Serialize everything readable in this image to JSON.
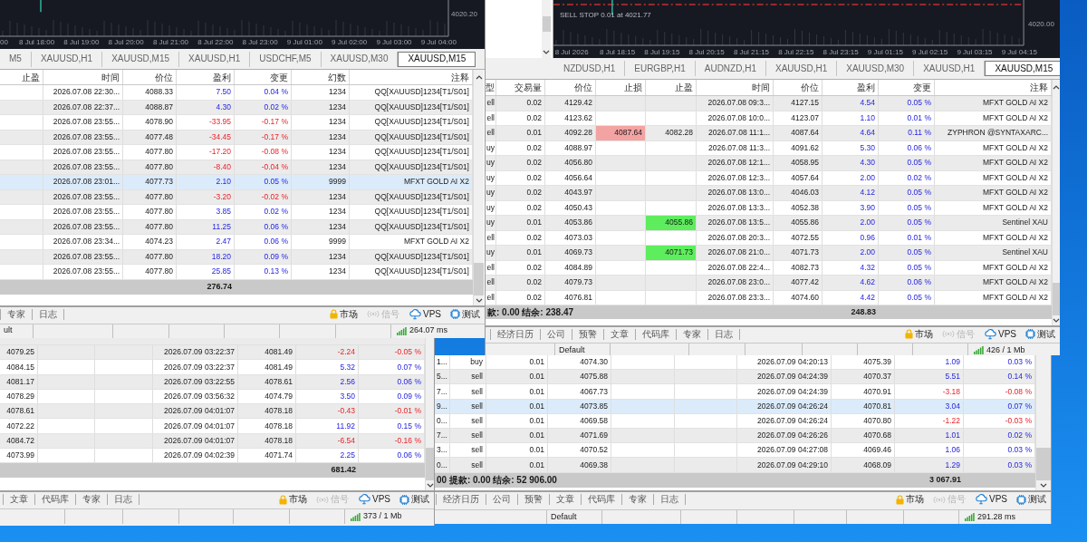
{
  "windows": [
    {
      "chart": {
        "time_labels": [
          "00",
          "8 Jul 18:00",
          "8 Jul 19:00",
          "8 Jul 20:00",
          "8 Jul 21:00",
          "8 Jul 22:00",
          "8 Jul 23:00",
          "9 Jul 01:00",
          "9 Jul 02:00",
          "9 Jul 03:00",
          "9 Jul 04:00"
        ],
        "price_labels": [
          "4020.20"
        ]
      },
      "chart_tabs": [
        {
          "label": "M5",
          "selected": false
        },
        {
          "label": "XAUUSD,H1",
          "selected": false
        },
        {
          "label": "XAUUSD,M15",
          "selected": false
        },
        {
          "label": "XAUUSD,H1",
          "selected": false
        },
        {
          "label": "USDCHF,M5",
          "selected": false
        },
        {
          "label": "XAUUSD,M30",
          "selected": false
        },
        {
          "label": "XAUUSD,M15",
          "selected": true
        }
      ],
      "table": {
        "columns": [
          "止盈",
          "时间",
          "价位",
          "盈利",
          "变更",
          "幻数",
          "注释"
        ],
        "rows": [
          {
            "cells": [
              null,
              "2026.07.08 22:30...",
              "4088.33",
              "7.50",
              "0.04 %",
              "1234",
              "QQ[XAUUSD]1234[T1/S01]"
            ],
            "negative": false,
            "selected": false
          },
          {
            "cells": [
              null,
              "2026.07.08 22:37...",
              "4088.87",
              "4.30",
              "0.02 %",
              "1234",
              "QQ[XAUUSD]1234[T1/S01]"
            ],
            "negative": false,
            "selected": false
          },
          {
            "cells": [
              null,
              "2026.07.08 23:55...",
              "4078.90",
              "-33.95",
              "-0.17 %",
              "1234",
              "QQ[XAUUSD]1234[T1/S01]"
            ],
            "negative": true,
            "selected": false
          },
          {
            "cells": [
              null,
              "2026.07.08 23:55...",
              "4077.48",
              "-34.45",
              "-0.17 %",
              "1234",
              "QQ[XAUUSD]1234[T1/S01]"
            ],
            "negative": true,
            "selected": false
          },
          {
            "cells": [
              null,
              "2026.07.08 23:55...",
              "4077.80",
              "-17.20",
              "-0.08 %",
              "1234",
              "QQ[XAUUSD]1234[T1/S01]"
            ],
            "negative": true,
            "selected": false
          },
          {
            "cells": [
              null,
              "2026.07.08 23:55...",
              "4077.80",
              "-8.40",
              "-0.04 %",
              "1234",
              "QQ[XAUUSD]1234[T1/S01]"
            ],
            "negative": true,
            "selected": false
          },
          {
            "cells": [
              null,
              "2026.07.08 23:01...",
              "4077.73",
              "2.10",
              "0.05 %",
              "9999",
              "MFXT GOLD AI X2"
            ],
            "negative": false,
            "selected": true
          },
          {
            "cells": [
              null,
              "2026.07.08 23:55...",
              "4077.80",
              "-3.20",
              "-0.02 %",
              "1234",
              "QQ[XAUUSD]1234[T1/S01]"
            ],
            "negative": true,
            "selected": false
          },
          {
            "cells": [
              null,
              "2026.07.08 23:55...",
              "4077.80",
              "3.85",
              "0.02 %",
              "1234",
              "QQ[XAUUSD]1234[T1/S01]"
            ],
            "negative": false,
            "selected": false
          },
          {
            "cells": [
              null,
              "2026.07.08 23:55...",
              "4077.80",
              "11.25",
              "0.06 %",
              "1234",
              "QQ[XAUUSD]1234[T1/S01]"
            ],
            "negative": false,
            "selected": false
          },
          {
            "cells": [
              null,
              "2026.07.08 23:34...",
              "4074.23",
              "2.47",
              "0.06 %",
              "9999",
              "MFXT GOLD AI X2"
            ],
            "negative": false,
            "selected": false
          },
          {
            "cells": [
              null,
              "2026.07.08 23:55...",
              "4077.80",
              "18.20",
              "0.09 %",
              "1234",
              "QQ[XAUUSD]1234[T1/S01]"
            ],
            "negative": false,
            "selected": false
          },
          {
            "cells": [
              null,
              "2026.07.08 23:55...",
              "4077.80",
              "25.85",
              "0.13 %",
              "1234",
              "QQ[XAUUSD]1234[T1/S01]"
            ],
            "negative": false,
            "selected": false
          }
        ],
        "total": {
          "profit": "276.74"
        }
      },
      "bottom_tabs": [
        "专家",
        "日志"
      ],
      "services": [
        {
          "kind": "market",
          "label": "市场",
          "disabled": false
        },
        {
          "kind": "signals",
          "label": "信号",
          "disabled": true
        },
        {
          "kind": "vps",
          "label": "VPS",
          "disabled": false
        },
        {
          "kind": "tester",
          "label": "测试",
          "disabled": false
        }
      ],
      "status": {
        "profile": "ult",
        "connection": "264.07 ms"
      }
    },
    {
      "chart": {
        "time_labels": [
          "8 Jul 2026",
          "8 Jul 18:15",
          "8 Jul 19:15",
          "8 Jul 20:15",
          "8 Jul 21:15",
          "8 Jul 22:15",
          "8 Jul 23:15",
          "9 Jul 01:15",
          "9 Jul 02:15",
          "9 Jul 03:15",
          "9 Jul 04:15"
        ],
        "price_labels": [
          "4020.00"
        ],
        "order_label": "SELL STOP 0.01 at 4021.77"
      },
      "chart_tabs": [
        {
          "label": "NZDUSD,H1",
          "selected": false
        },
        {
          "label": "EURGBP,H1",
          "selected": false
        },
        {
          "label": "AUDNZD,H1",
          "selected": false
        },
        {
          "label": "XAUUSD,H1",
          "selected": false
        },
        {
          "label": "XAUUSD,M30",
          "selected": false
        },
        {
          "label": "XAUUSD,H1",
          "selected": false
        },
        {
          "label": "XAUUSD,M15",
          "selected": true
        }
      ],
      "table": {
        "columns": [
          "型",
          "交易量",
          "价位",
          "止损",
          "止盈",
          "时间",
          "价位",
          "盈利",
          "变更",
          "注释"
        ],
        "rows": [
          {
            "cells": [
              "ell",
              "0.02",
              "4129.42",
              null,
              null,
              "2026.07.08 09:3...",
              "4127.15",
              "4.54",
              "0.05 %",
              "MFXT GOLD AI X2"
            ],
            "negative": false,
            "selected": false,
            "sl_hit": false,
            "tp_hit": false
          },
          {
            "cells": [
              "ell",
              "0.02",
              "4123.62",
              null,
              null,
              "2026.07.08 10:0...",
              "4123.07",
              "1.10",
              "0.01 %",
              "MFXT GOLD AI X2"
            ],
            "negative": false,
            "selected": false,
            "sl_hit": false,
            "tp_hit": false
          },
          {
            "cells": [
              "ell",
              "0.01",
              "4092.28",
              "4087.64",
              "4082.28",
              "2026.07.08 11:1...",
              "4087.64",
              "4.64",
              "0.11 %",
              "ZYPHRON @SYNTAXARC..."
            ],
            "negative": false,
            "selected": false,
            "sl_hit": true,
            "tp_hit": false
          },
          {
            "cells": [
              "uy",
              "0.02",
              "4088.97",
              null,
              null,
              "2026.07.08 11:3...",
              "4091.62",
              "5.30",
              "0.06 %",
              "MFXT GOLD AI X2"
            ],
            "negative": false,
            "selected": false,
            "sl_hit": false,
            "tp_hit": false
          },
          {
            "cells": [
              "uy",
              "0.02",
              "4056.80",
              null,
              null,
              "2026.07.08 12:1...",
              "4058.95",
              "4.30",
              "0.05 %",
              "MFXT GOLD AI X2"
            ],
            "negative": false,
            "selected": false,
            "sl_hit": false,
            "tp_hit": false
          },
          {
            "cells": [
              "uy",
              "0.02",
              "4056.64",
              null,
              null,
              "2026.07.08 12:3...",
              "4057.64",
              "2.00",
              "0.02 %",
              "MFXT GOLD AI X2"
            ],
            "negative": false,
            "selected": false,
            "sl_hit": false,
            "tp_hit": false
          },
          {
            "cells": [
              "uy",
              "0.02",
              "4043.97",
              null,
              null,
              "2026.07.08 13:0...",
              "4046.03",
              "4.12",
              "0.05 %",
              "MFXT GOLD AI X2"
            ],
            "negative": false,
            "selected": false,
            "sl_hit": false,
            "tp_hit": false
          },
          {
            "cells": [
              "uy",
              "0.02",
              "4050.43",
              null,
              null,
              "2026.07.08 13:3...",
              "4052.38",
              "3.90",
              "0.05 %",
              "MFXT GOLD AI X2"
            ],
            "negative": false,
            "selected": false,
            "sl_hit": false,
            "tp_hit": false
          },
          {
            "cells": [
              "uy",
              "0.01",
              "4053.86",
              null,
              "4055.86",
              "2026.07.08 13:5...",
              "4055.86",
              "2.00",
              "0.05 %",
              "Sentinel XAU"
            ],
            "negative": false,
            "selected": false,
            "sl_hit": false,
            "tp_hit": true
          },
          {
            "cells": [
              "ell",
              "0.02",
              "4073.03",
              null,
              null,
              "2026.07.08 20:3...",
              "4072.55",
              "0.96",
              "0.01 %",
              "MFXT GOLD AI X2"
            ],
            "negative": false,
            "selected": false,
            "sl_hit": false,
            "tp_hit": false
          },
          {
            "cells": [
              "uy",
              "0.01",
              "4069.73",
              null,
              "4071.73",
              "2026.07.08 21:0...",
              "4071.73",
              "2.00",
              "0.05 %",
              "Sentinel XAU"
            ],
            "negative": false,
            "selected": false,
            "sl_hit": false,
            "tp_hit": true
          },
          {
            "cells": [
              "ell",
              "0.02",
              "4084.89",
              null,
              null,
              "2026.07.08 22:4...",
              "4082.73",
              "4.32",
              "0.05 %",
              "MFXT GOLD AI X2"
            ],
            "negative": false,
            "selected": false,
            "sl_hit": false,
            "tp_hit": false
          },
          {
            "cells": [
              "ell",
              "0.02",
              "4079.73",
              null,
              null,
              "2026.07.08 23:0...",
              "4077.42",
              "4.62",
              "0.06 %",
              "MFXT GOLD AI X2"
            ],
            "negative": false,
            "selected": false,
            "sl_hit": false,
            "tp_hit": false
          },
          {
            "cells": [
              "ell",
              "0.02",
              "4076.81",
              null,
              null,
              "2026.07.08 23:3...",
              "4074.60",
              "4.42",
              "0.05 %",
              "MFXT GOLD AI X2"
            ],
            "negative": false,
            "selected": false,
            "sl_hit": false,
            "tp_hit": false
          }
        ],
        "total": {
          "summary": "款: 0.00  结余: 238.47",
          "profit": "248.83"
        }
      },
      "bottom_tabs": [
        "经济日历",
        "公司",
        "预警",
        "文章",
        "代码库",
        "专家",
        "日志"
      ],
      "services": [
        {
          "kind": "market",
          "label": "市场",
          "disabled": false
        },
        {
          "kind": "signals",
          "label": "信号",
          "disabled": true
        },
        {
          "kind": "vps",
          "label": "VPS",
          "disabled": false
        },
        {
          "kind": "tester",
          "label": "测试",
          "disabled": false
        }
      ],
      "status": {
        "profile": "Default",
        "connection": "426 / 1 Mb"
      }
    },
    {
      "table": {
        "rows": [
          {
            "cells": [
              "4079.25",
              null,
              null,
              "2026.07.09 03:22:37",
              "4081.49",
              "-2.24",
              "-0.05 %"
            ],
            "negative": true,
            "selected": false
          },
          {
            "cells": [
              "4084.15",
              null,
              null,
              "2026.07.09 03:22:37",
              "4081.49",
              "5.32",
              "0.07 %"
            ],
            "negative": false,
            "selected": false
          },
          {
            "cells": [
              "4081.17",
              null,
              null,
              "2026.07.09 03:22:55",
              "4078.61",
              "2.56",
              "0.06 %"
            ],
            "negative": false,
            "selected": false
          },
          {
            "cells": [
              "4078.29",
              null,
              null,
              "2026.07.09 03:56:32",
              "4074.79",
              "3.50",
              "0.09 %"
            ],
            "negative": false,
            "selected": false
          },
          {
            "cells": [
              "4078.61",
              null,
              null,
              "2026.07.09 04:01:07",
              "4078.18",
              "-0.43",
              "-0.01 %"
            ],
            "negative": true,
            "selected": false
          },
          {
            "cells": [
              "4072.22",
              null,
              null,
              "2026.07.09 04:01:07",
              "4078.18",
              "11.92",
              "0.15 %"
            ],
            "negative": false,
            "selected": false
          },
          {
            "cells": [
              "4084.72",
              null,
              null,
              "2026.07.09 04:01:07",
              "4078.18",
              "-6.54",
              "-0.16 %"
            ],
            "negative": true,
            "selected": false
          },
          {
            "cells": [
              "4073.99",
              null,
              null,
              "2026.07.09 04:02:39",
              "4071.74",
              "2.25",
              "0.06 %"
            ],
            "negative": false,
            "selected": false
          }
        ],
        "total": {
          "profit": "681.42"
        }
      },
      "bottom_tabs": [
        "文章",
        "代码库",
        "专家",
        "日志"
      ],
      "services": [
        {
          "kind": "market",
          "label": "市场",
          "disabled": false
        },
        {
          "kind": "signals",
          "label": "信号",
          "disabled": true
        },
        {
          "kind": "vps",
          "label": "VPS",
          "disabled": false
        },
        {
          "kind": "tester",
          "label": "测试",
          "disabled": false
        }
      ],
      "status": {
        "connection": "373 / 1 Mb"
      }
    },
    {
      "table": {
        "rows": [
          {
            "cells": [
              "1...",
              "buy",
              "0.01",
              "4074.30",
              null,
              null,
              "2026.07.09 04:20:13",
              "4075.39",
              "1.09",
              "0.03 %"
            ],
            "negative": false,
            "selected": false
          },
          {
            "cells": [
              "5...",
              "sell",
              "0.01",
              "4075.88",
              null,
              null,
              "2026.07.09 04:24:39",
              "4070.37",
              "5.51",
              "0.14 %"
            ],
            "negative": false,
            "selected": false
          },
          {
            "cells": [
              "7...",
              "sell",
              "0.01",
              "4067.73",
              null,
              null,
              "2026.07.09 04:24:39",
              "4070.91",
              "-3.18",
              "-0.08 %"
            ],
            "negative": true,
            "selected": false
          },
          {
            "cells": [
              "9...",
              "sell",
              "0.01",
              "4073.85",
              null,
              null,
              "2026.07.09 04:26:24",
              "4070.81",
              "3.04",
              "0.07 %"
            ],
            "negative": false,
            "selected": true
          },
          {
            "cells": [
              "0...",
              "sell",
              "0.01",
              "4069.58",
              null,
              null,
              "2026.07.09 04:26:24",
              "4070.80",
              "-1.22",
              "-0.03 %"
            ],
            "negative": true,
            "selected": false
          },
          {
            "cells": [
              "7...",
              "sell",
              "0.01",
              "4071.69",
              null,
              null,
              "2026.07.09 04:26:26",
              "4070.68",
              "1.01",
              "0.02 %"
            ],
            "negative": false,
            "selected": false
          },
          {
            "cells": [
              "3...",
              "sell",
              "0.01",
              "4070.52",
              null,
              null,
              "2026.07.09 04:27:08",
              "4069.46",
              "1.06",
              "0.03 %"
            ],
            "negative": false,
            "selected": false
          },
          {
            "cells": [
              "0...",
              "sell",
              "0.01",
              "4069.38",
              null,
              null,
              "2026.07.09 04:29:10",
              "4068.09",
              "1.29",
              "0.03 %"
            ],
            "negative": false,
            "selected": false
          }
        ],
        "total": {
          "summary": "00  提款: 0.00  结余: 52 906.00",
          "profit": "3 067.91"
        }
      },
      "bottom_tabs": [
        "经济日历",
        "公司",
        "预警",
        "文章",
        "代码库",
        "专家",
        "日志"
      ],
      "services": [
        {
          "kind": "market",
          "label": "市场",
          "disabled": false
        },
        {
          "kind": "signals",
          "label": "信号",
          "disabled": true
        },
        {
          "kind": "vps",
          "label": "VPS",
          "disabled": false
        },
        {
          "kind": "tester",
          "label": "测试",
          "disabled": false
        }
      ],
      "status": {
        "profile": "Default",
        "connection": "291.28 ms"
      }
    }
  ]
}
